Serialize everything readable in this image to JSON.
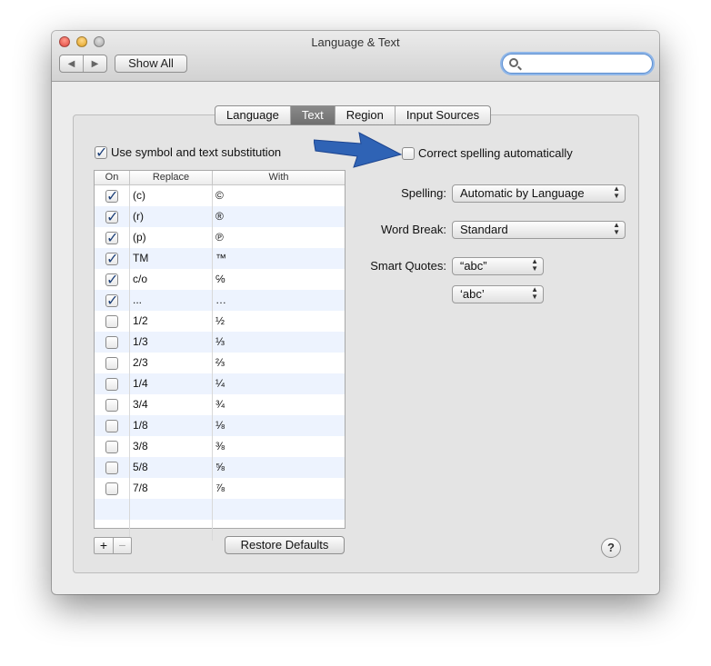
{
  "window": {
    "title": "Language & Text"
  },
  "toolbar": {
    "back_icon": "◀",
    "forward_icon": "▶",
    "show_all": "Show All",
    "search_placeholder": ""
  },
  "tabs": [
    {
      "label": "Language",
      "active": false
    },
    {
      "label": "Text",
      "active": true
    },
    {
      "label": "Region",
      "active": false
    },
    {
      "label": "Input Sources",
      "active": false
    }
  ],
  "substitution": {
    "use_label": "Use symbol and text substitution",
    "use_checked": true,
    "headers": {
      "on": "On",
      "replace": "Replace",
      "with": "With"
    },
    "rows": [
      {
        "on": true,
        "replace": "(c)",
        "with": "©"
      },
      {
        "on": true,
        "replace": "(r)",
        "with": "®"
      },
      {
        "on": true,
        "replace": "(p)",
        "with": "℗"
      },
      {
        "on": true,
        "replace": "TM",
        "with": "™"
      },
      {
        "on": true,
        "replace": "c/o",
        "with": "℅"
      },
      {
        "on": true,
        "replace": "...",
        "with": "…"
      },
      {
        "on": false,
        "replace": "1/2",
        "with": "½"
      },
      {
        "on": false,
        "replace": "1/3",
        "with": "⅓"
      },
      {
        "on": false,
        "replace": "2/3",
        "with": "⅔"
      },
      {
        "on": false,
        "replace": "1/4",
        "with": "¼"
      },
      {
        "on": false,
        "replace": "3/4",
        "with": "¾"
      },
      {
        "on": false,
        "replace": "1/8",
        "with": "⅛"
      },
      {
        "on": false,
        "replace": "3/8",
        "with": "⅜"
      },
      {
        "on": false,
        "replace": "5/8",
        "with": "⅝"
      },
      {
        "on": false,
        "replace": "7/8",
        "with": "⅞"
      }
    ],
    "add_icon": "+",
    "remove_icon": "−",
    "restore_label": "Restore Defaults"
  },
  "spelling_options": {
    "correct_label": "Correct spelling automatically",
    "correct_checked": false,
    "spelling_label": "Spelling:",
    "spelling_value": "Automatic by Language",
    "wordbreak_label": "Word Break:",
    "wordbreak_value": "Standard",
    "quotes_label": "Smart Quotes:",
    "double_quotes_value": "“abc”",
    "single_quotes_value": "‘abc’"
  },
  "help": "?",
  "colors": {
    "arrow": "#2f63b5",
    "active_tab": "#7a7a7a",
    "row_stripe": "#edf3fe"
  }
}
